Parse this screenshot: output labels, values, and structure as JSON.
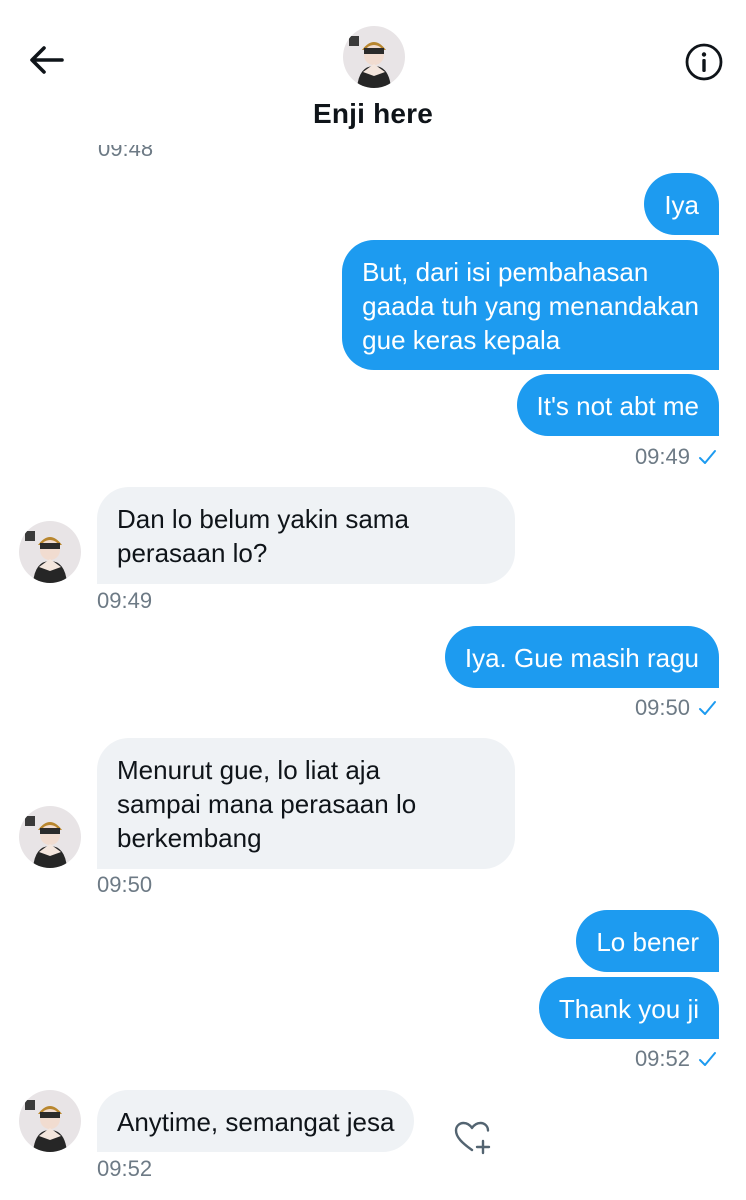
{
  "header": {
    "title": "Enji here",
    "back_icon": "back-arrow-icon",
    "info_icon": "info-icon"
  },
  "clipped_timestamp": "09:48",
  "messages": [
    {
      "direction": "out",
      "text": "Iya"
    },
    {
      "direction": "out",
      "text": "But, dari isi pembahasan\ngaada tuh yang menandakan\ngue keras kepala"
    },
    {
      "direction": "out",
      "text": "It's not abt me"
    },
    {
      "direction": "in",
      "text": "Dan lo belum yakin sama\nperasaan lo?"
    },
    {
      "direction": "out",
      "text": "Iya. Gue masih ragu"
    },
    {
      "direction": "in",
      "text": "Menurut gue, lo liat aja\nsampai mana perasaan lo\nberkembang"
    },
    {
      "direction": "out",
      "text": "Lo bener"
    },
    {
      "direction": "out",
      "text": "Thank you ji"
    },
    {
      "direction": "in",
      "text": "Anytime, semangat jesa"
    }
  ],
  "timestamps": [
    "09:49",
    "09:49",
    "09:50",
    "09:50",
    "09:52",
    "09:52"
  ],
  "colors": {
    "outgoing_bubble": "#1d9bf0",
    "incoming_bubble": "#eff2f5",
    "timestamp": "#6d7a85",
    "read_check": "#1d9bf0"
  }
}
